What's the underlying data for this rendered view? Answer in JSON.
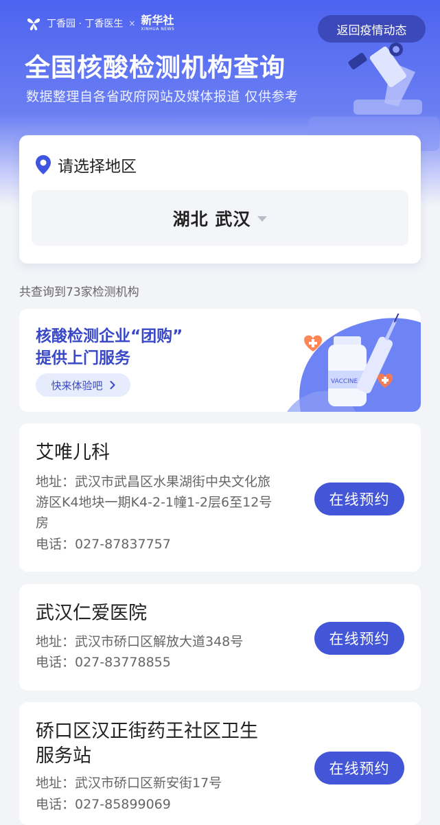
{
  "header": {
    "brand_dxy": "丁香园 · 丁香医生",
    "brand_sep": "×",
    "brand_xinhua_cn": "新华社",
    "brand_xinhua_en": "XINHUA NEWS",
    "back_button_label": "返回疫情动态",
    "title": "全国核酸检测机构查询",
    "subtitle": "数据整理自各省政府网站及媒体报道 仅供参考"
  },
  "region": {
    "label": "请选择地区",
    "selected_value": "湖北 武汉"
  },
  "result_count": "共查询到73家检测机构",
  "banner": {
    "title_line1": "核酸检测企业“团购”",
    "title_line2": "提供上门服务",
    "button_label": "快来体验吧",
    "vial_label": "VACCINE"
  },
  "organizations": [
    {
      "name": "艾唯儿科",
      "address_line1": "地址：武汉市武昌区水果湖街中央文化旅",
      "address_line2": "游区K4地块一期K4-2-1幢1-2层6至12号",
      "address_line3": "房",
      "phone": "电话：027-87837757",
      "button_label": "在线预约"
    },
    {
      "name": "武汉仁爱医院",
      "address_line1": "地址：武汉市硚口区解放大道348号",
      "phone": "电话：027-83778855",
      "button_label": "在线预约"
    },
    {
      "name_line1": "硚口区汉正街药王社区卫生",
      "name_line2": "服务站",
      "address_line1": "地址：武汉市硚口区新安街17号",
      "phone": "电话：027-85899069",
      "button_label": "在线预约"
    }
  ],
  "colors": {
    "primary": "#4456d8",
    "header_gradient_top": "#4d63f0",
    "page_bg": "#f3f4f8",
    "banner_title": "#3848c8"
  },
  "icons": {
    "location": "location-pin-icon",
    "dropdown": "caret-down-icon",
    "chevron": "chevron-right-icon",
    "brand": "dxy-flower-icon"
  }
}
